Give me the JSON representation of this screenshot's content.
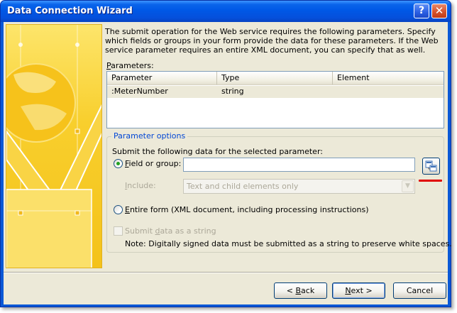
{
  "window": {
    "title": "Data Connection Wizard",
    "help_glyph": "?",
    "close_glyph": "✕"
  },
  "description": "The submit operation for the Web service requires the following parameters. Specify which fields or groups in your form provide the data for these parameters. If the Web service parameter requires an entire XML document, you can specify that as well.",
  "parameters": {
    "label_mnemonic": "P",
    "label_rest": "arameters:",
    "columns": [
      "Parameter",
      "Type",
      "Element"
    ],
    "rows": [
      {
        "parameter": ":MeterNumber",
        "type": "string",
        "element": ""
      }
    ]
  },
  "parameter_options": {
    "title": "Parameter options",
    "instruction": "Submit the following data for the selected parameter:",
    "field_or_group": {
      "mnemonic": "F",
      "rest": "ield or group:",
      "value": "",
      "checked": true
    },
    "include": {
      "mnemonic": "I",
      "rest": "nclude:",
      "selected": "Text and child elements only",
      "arrow": "▼"
    },
    "entire_form": {
      "mnemonic": "E",
      "rest": "ntire form (XML document, including processing instructions)",
      "checked": false
    },
    "submit_as_string": {
      "pre": "Submit ",
      "mnemonic": "d",
      "rest": "ata as a string",
      "checked": false
    },
    "note": "Note: Digitally signed data must be submitted as a string to preserve white spaces."
  },
  "buttons": {
    "back": {
      "pre": "< ",
      "mnemonic": "B",
      "rest": "ack"
    },
    "next": {
      "mnemonic": "N",
      "rest": "ext >"
    },
    "cancel": "Cancel"
  },
  "icons": {
    "picker": "select-xpath-icon",
    "accent": "#e00000"
  }
}
